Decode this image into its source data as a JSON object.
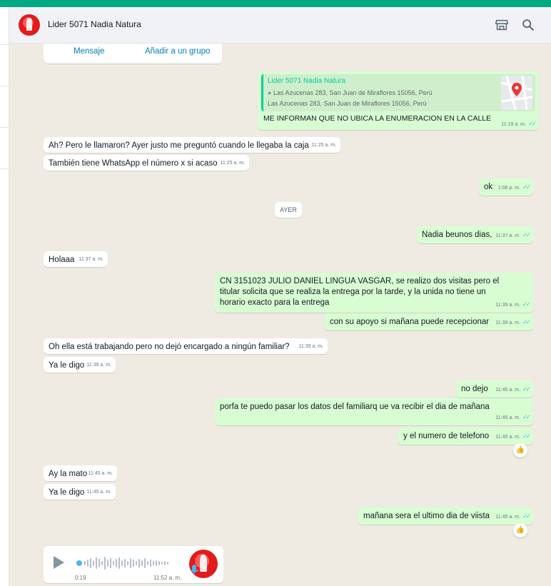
{
  "header": {
    "title": "Lider 5071 Nadia Natura",
    "icons": [
      "store-icon",
      "search-icon"
    ]
  },
  "contact_card": {
    "message_button": "Mensaje",
    "add_group_button": "Añadir a un grupo"
  },
  "location": {
    "name": "Lider 5071 Nadia Natura",
    "address_1": "Las Azucenas 283, San Juan de Miraflores 15056, Perú",
    "address_2": "Las Azucenas 283, San Juan de Miraflores 15056, Perú",
    "text": "ME INFORMAN QUE NO UBICA LA ENUMERACION EN LA CALLE",
    "time": "11:19 a. m."
  },
  "day_separator": "AYER",
  "messages": [
    {
      "dir": "in",
      "text": "Ah? Pero le llamaron? Ayer justo me preguntó cuando le llegaba la caja",
      "time": "11:25 a. m."
    },
    {
      "dir": "in",
      "text": "También tiene WhatsApp el número x si acaso",
      "time": "11:25 a. m."
    },
    {
      "dir": "out",
      "text": "ok",
      "time": "1:06 p. m."
    },
    {
      "dir": "out",
      "text": "Nadia beunos dias,",
      "time": "11:37 a. m."
    },
    {
      "dir": "in",
      "text": "Holaaa",
      "time": "11:37 a. m."
    },
    {
      "dir": "out",
      "text": "CN 3151023 JULIO DANIEL LINGUA VASGAR, se realizo dos visitas pero el titular solicita que se realiza la entrega por la tarde, y la unida no tiene un horario exacto para la entrega",
      "time": "11:39 a. m."
    },
    {
      "dir": "out",
      "text": "con su apoyo si mañana puede recepcionar",
      "time": "11:39 a. m."
    },
    {
      "dir": "in",
      "text": "Oh ella está trabajando pero no dejó encargado a ningún familiar?",
      "time": "11:39 a. m."
    },
    {
      "dir": "in",
      "text": "Ya le digo",
      "time": "11:39 a. m."
    },
    {
      "dir": "out",
      "text": "no dejo",
      "time": "11:45 a. m."
    },
    {
      "dir": "out",
      "text": "porfa te puedo pasar los datos del familiarq ue va recibir el dia de mañana",
      "time": "11:45 a. m."
    },
    {
      "dir": "out",
      "text": "y el numero de telefono",
      "time": "11:45 a. m.",
      "reaction": "👍"
    },
    {
      "dir": "in",
      "text": "Ay la mato",
      "time": "11:45 a. m."
    },
    {
      "dir": "in",
      "text": "Ya le digo",
      "time": "11:45 a. m."
    },
    {
      "dir": "out",
      "text": "mañana sera el ultimo dia de viista",
      "time": "11:45 a. m.",
      "reaction": "👍"
    }
  ],
  "voice_note": {
    "duration": "0:19",
    "time": "11:52 a. m."
  },
  "colors": {
    "accent": "#00a884",
    "outgoing_bubble": "#d9fdd3",
    "incoming_bubble": "#ffffff",
    "chat_background": "#efeae2",
    "read_tick": "#53bdeb"
  }
}
